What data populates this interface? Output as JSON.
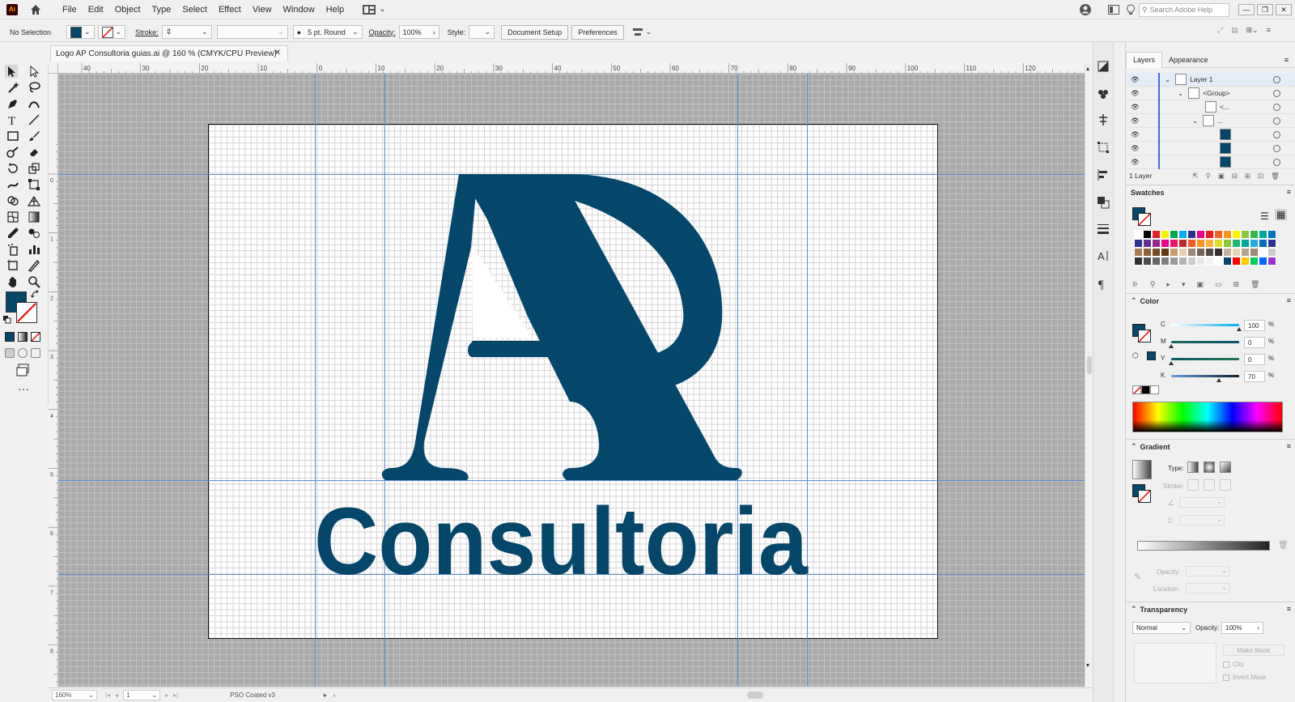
{
  "app": {
    "icon_text": "Ai"
  },
  "menu": [
    "File",
    "Edit",
    "Object",
    "Type",
    "Select",
    "Effect",
    "View",
    "Window",
    "Help"
  ],
  "help_search": {
    "placeholder": "Search Adobe Help"
  },
  "controlbar": {
    "selection": "No Selection",
    "stroke_label": "Stroke:",
    "brush": "5 pt. Round",
    "opacity_label": "Opacity:",
    "opacity_value": "100%",
    "style_label": "Style:",
    "document_setup": "Document Setup",
    "preferences": "Preferences"
  },
  "document": {
    "tab_title": "Logo AP Consultoria guias.ai @ 160 % (CMYK/CPU Preview)"
  },
  "rulers": {
    "h_labels": [
      "40",
      "30",
      "20",
      "10",
      "0",
      "10",
      "20",
      "30",
      "40",
      "50",
      "60",
      "70",
      "80",
      "90",
      "100",
      "110",
      "120"
    ],
    "v_labels": [
      "0",
      "1",
      "2",
      "3",
      "4",
      "5",
      "6",
      "7",
      "8"
    ]
  },
  "artwork": {
    "logo_text": "Consultoria",
    "brand_color": "#05476a"
  },
  "status": {
    "zoom": "160%",
    "artboard": "1",
    "profile": "PSO Coated v3"
  },
  "layers_panel": {
    "tabs": [
      "Layers",
      "Appearance"
    ],
    "rows": [
      {
        "label": "Layer 1"
      },
      {
        "label": "<Group>"
      },
      {
        "label": "<..."
      },
      {
        "label": "..."
      },
      {
        "label": ""
      },
      {
        "label": ""
      },
      {
        "label": ""
      }
    ],
    "footer": "1 Layer"
  },
  "swatches_panel": {
    "title": "Swatches"
  },
  "color_panel": {
    "title": "Color",
    "channels": [
      {
        "label": "C",
        "value": "100",
        "fraction": 1.0
      },
      {
        "label": "M",
        "value": "0",
        "fraction": 0.0
      },
      {
        "label": "Y",
        "value": "0",
        "fraction": 0.0
      },
      {
        "label": "K",
        "value": "70",
        "fraction": 0.7
      }
    ],
    "percent": "%"
  },
  "gradient_panel": {
    "title": "Gradient",
    "type_label": "Type:",
    "stroke_label": "Stroke:",
    "opacity_label": "Opacity:",
    "location_label": "Location:"
  },
  "transparency_panel": {
    "title": "Transparency",
    "blend_mode": "Normal",
    "opacity_label": "Opacity:",
    "opacity_value": "100%",
    "make_mask": "Make Mask",
    "clip": "Clip",
    "invert_mask": "Invert Mask"
  },
  "colors": {
    "accent_blue": "#5b8ed0",
    "fill": "#05476a"
  }
}
